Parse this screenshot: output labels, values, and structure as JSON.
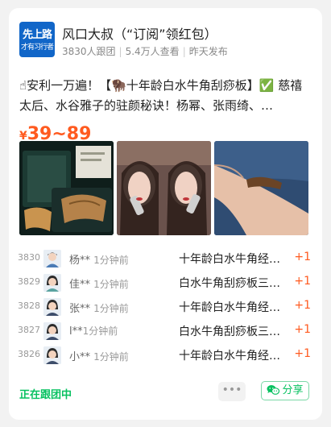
{
  "author": {
    "avatar_text_line1": "先上路",
    "avatar_text_line2": "才有习行者",
    "name": "风口大叔（“订阅”领红包）",
    "followers": "3830人跟团",
    "views": "5.4万人查看",
    "published": "昨天发布"
  },
  "product": {
    "description": "☝安利一万遍！【🦬十年龄白水牛角刮痧板】✅ 慈禧太后、水谷雅子的驻颜秘诀！杨幂、张雨绮、…",
    "price_symbol": "¥",
    "price_range": "39~89"
  },
  "buyers": [
    {
      "rank": "3830",
      "name": "杨**",
      "time": "1分钟前",
      "item": "十年龄白水牛角经…",
      "qty": "+1"
    },
    {
      "rank": "3829",
      "name": "佳**",
      "time": "1分钟前",
      "item": "白水牛角刮痧板三…",
      "qty": "+1"
    },
    {
      "rank": "3828",
      "name": "张**",
      "time": "1分钟前",
      "item": "十年龄白水牛角经…",
      "qty": "+1"
    },
    {
      "rank": "3827",
      "name": "l**",
      "time": "1分钟前",
      "item": "白水牛角刮痧板三…",
      "qty": "+1"
    },
    {
      "rank": "3826",
      "name": "小**",
      "time": "1分钟前",
      "item": "十年龄白水牛角经…",
      "qty": "+1"
    }
  ],
  "footer": {
    "status": "正在跟团中",
    "more": "•••",
    "share": "分享"
  },
  "colors": {
    "accent": "#07c160",
    "price": "#ff5a1f"
  }
}
